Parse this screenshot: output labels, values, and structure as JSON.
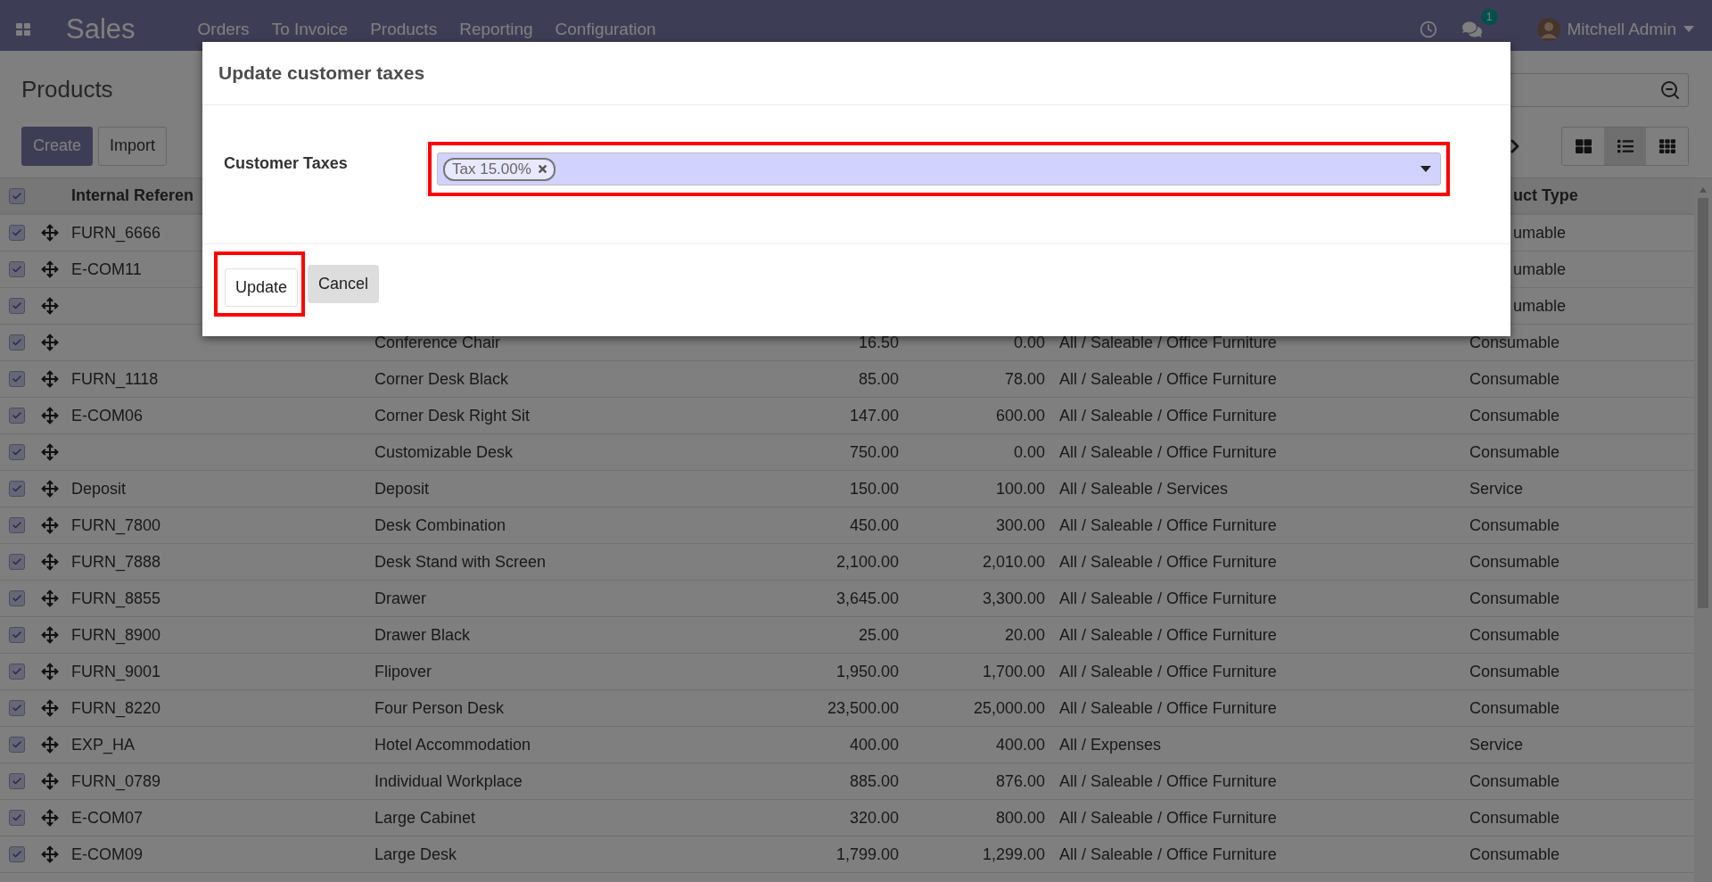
{
  "navbar": {
    "app_title": "Sales",
    "menu": [
      "Orders",
      "To Invoice",
      "Products",
      "Reporting",
      "Configuration"
    ],
    "chat_count": "1",
    "user": "Mitchell Admin"
  },
  "control_panel": {
    "title": "Products",
    "buttons": [
      {
        "label": "Create",
        "kind": "primary"
      },
      {
        "label": "Import",
        "kind": "secondary"
      }
    ],
    "views": [
      {
        "kind": "kanban",
        "selected": false
      },
      {
        "kind": "list",
        "selected": true
      },
      {
        "kind": "grid",
        "selected": false
      }
    ]
  },
  "table": {
    "header_checked": true,
    "columns": [
      {
        "label": "Internal Referen"
      },
      {
        "label": "uct Type"
      }
    ],
    "rows": [
      {
        "checked": true,
        "reference": "FURN_6666",
        "product_type": "umable"
      },
      {
        "checked": true,
        "reference": "E-COM11",
        "product_type": "umable"
      },
      {
        "checked": true,
        "product_type": "umable"
      },
      {
        "checked": true,
        "name": "Conference Chair",
        "sales_price": "16.50",
        "cost": "0.00",
        "category": "All / Saleable / Office Furniture",
        "product_type": "Consumable"
      },
      {
        "checked": true,
        "reference": "FURN_1118",
        "name": "Corner Desk Black",
        "sales_price": "85.00",
        "cost": "78.00",
        "category": "All / Saleable / Office Furniture",
        "product_type": "Consumable"
      },
      {
        "checked": true,
        "reference": "E-COM06",
        "name": "Corner Desk Right Sit",
        "sales_price": "147.00",
        "cost": "600.00",
        "category": "All / Saleable / Office Furniture",
        "product_type": "Consumable"
      },
      {
        "checked": true,
        "name": "Customizable Desk",
        "sales_price": "750.00",
        "cost": "0.00",
        "category": "All / Saleable / Office Furniture",
        "product_type": "Consumable"
      },
      {
        "checked": true,
        "reference": "Deposit",
        "name": "Deposit",
        "sales_price": "150.00",
        "cost": "100.00",
        "category": "All / Saleable / Services",
        "product_type": "Service"
      },
      {
        "checked": true,
        "reference": "FURN_7800",
        "name": "Desk Combination",
        "sales_price": "450.00",
        "cost": "300.00",
        "category": "All / Saleable / Office Furniture",
        "product_type": "Consumable"
      },
      {
        "checked": true,
        "reference": "FURN_7888",
        "name": "Desk Stand with Screen",
        "sales_price": "2,100.00",
        "cost": "2,010.00",
        "category": "All / Saleable / Office Furniture",
        "product_type": "Consumable"
      },
      {
        "checked": true,
        "reference": "FURN_8855",
        "name": "Drawer",
        "sales_price": "3,645.00",
        "cost": "3,300.00",
        "category": "All / Saleable / Office Furniture",
        "product_type": "Consumable"
      },
      {
        "checked": true,
        "reference": "FURN_8900",
        "name": "Drawer Black",
        "sales_price": "25.00",
        "cost": "20.00",
        "category": "All / Saleable / Office Furniture",
        "product_type": "Consumable"
      },
      {
        "checked": true,
        "reference": "FURN_9001",
        "name": "Flipover",
        "sales_price": "1,950.00",
        "cost": "1,700.00",
        "category": "All / Saleable / Office Furniture",
        "product_type": "Consumable"
      },
      {
        "checked": true,
        "reference": "FURN_8220",
        "name": "Four Person Desk",
        "sales_price": "23,500.00",
        "cost": "25,000.00",
        "category": "All / Saleable / Office Furniture",
        "product_type": "Consumable"
      },
      {
        "checked": true,
        "reference": "EXP_HA",
        "name": "Hotel Accommodation",
        "sales_price": "400.00",
        "cost": "400.00",
        "category": "All / Expenses",
        "product_type": "Service"
      },
      {
        "checked": true,
        "reference": "FURN_0789",
        "name": "Individual Workplace",
        "sales_price": "885.00",
        "cost": "876.00",
        "category": "All / Saleable / Office Furniture",
        "product_type": "Consumable"
      },
      {
        "checked": true,
        "reference": "E-COM07",
        "name": "Large Cabinet",
        "sales_price": "320.00",
        "cost": "800.00",
        "category": "All / Saleable / Office Furniture",
        "product_type": "Consumable"
      },
      {
        "checked": true,
        "reference": "E-COM09",
        "name": "Large Desk",
        "sales_price": "1,799.00",
        "cost": "1,299.00",
        "category": "All / Saleable / Office Furniture",
        "product_type": "Consumable"
      }
    ]
  },
  "dialog": {
    "title": "Update customer taxes",
    "field_label": "Customer Taxes",
    "field_highlighted": true,
    "tags": [
      "Tax 15.00%"
    ],
    "buttons": [
      {
        "label": "Update",
        "kind": "secondary",
        "highlighted": true
      },
      {
        "label": "Cancel",
        "kind": "muted",
        "highlighted": false
      }
    ]
  }
}
